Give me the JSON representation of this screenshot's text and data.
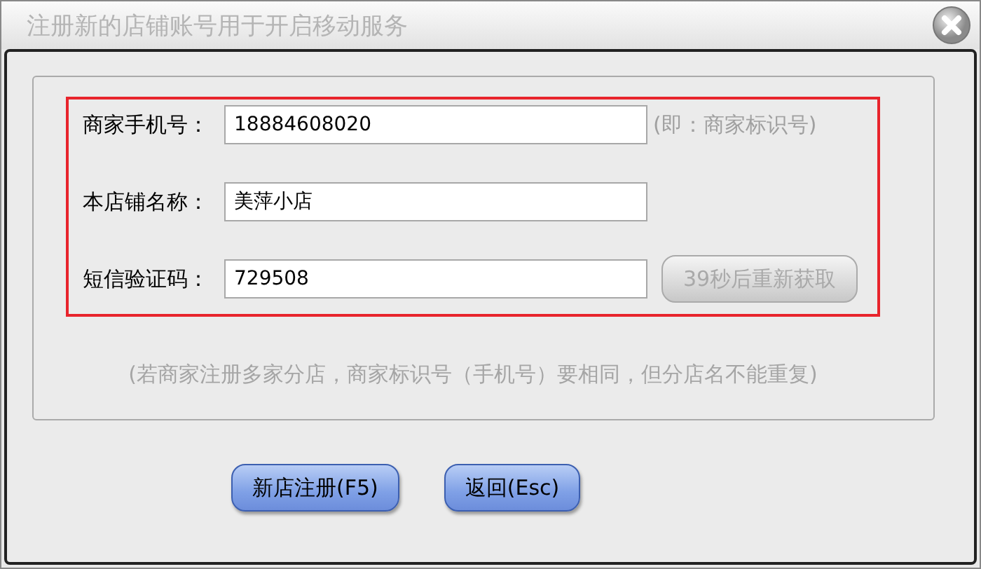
{
  "window": {
    "title": "注册新的店铺账号用于开启移动服务"
  },
  "fields": [
    {
      "label": "商家手机号：",
      "value": "18884608020",
      "hint": "(即：商家标识号)"
    },
    {
      "label": "本店铺名称：",
      "value": "美萍小店"
    },
    {
      "label": "短信验证码：",
      "value": "729508",
      "action": {
        "label": "39秒后重新获取",
        "disabled": true
      }
    }
  ],
  "note": "(若商家注册多家分店，商家标识号（手机号）要相同，但分店名不能重复)",
  "buttons": [
    "新店注册(F5)",
    "返回(Esc)"
  ]
}
